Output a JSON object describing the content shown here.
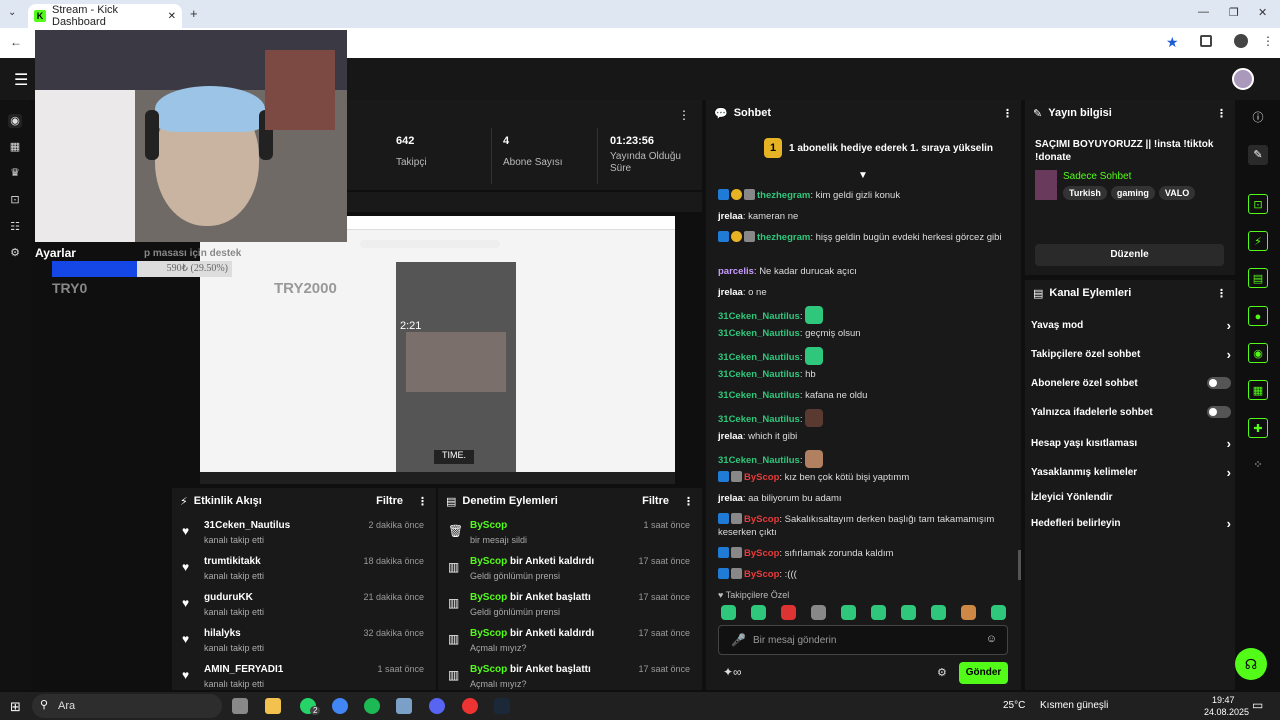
{
  "browser": {
    "tab_title": "Stream - Kick Dashboard"
  },
  "sidebar_overlay": {
    "settings_label": "Ayarlar",
    "goal_title": "TRY2000",
    "goal_current": "TRY0",
    "donate_label": "p masası için destek",
    "progress_text": "590₺ (29.50%)",
    "progress_value": 0.295
  },
  "stats": [
    {
      "value": "642",
      "label": "Takipçi"
    },
    {
      "value": "4",
      "label": "Abone Sayısı"
    },
    {
      "value": "01:23:56",
      "label": "Yayında Olduğu Süre"
    }
  ],
  "activity": {
    "title": "Etkinlik Akışı",
    "filter": "Filtre",
    "items": [
      {
        "name": "31Ceken_Nautilus",
        "sub": "kanalı takip etti",
        "time": "2 dakika önce"
      },
      {
        "name": "trumtikitakk",
        "sub": "kanalı takip etti",
        "time": "18 dakika önce"
      },
      {
        "name": "guduruKK",
        "sub": "kanalı takip etti",
        "time": "21 dakika önce"
      },
      {
        "name": "hilalyks",
        "sub": "kanalı takip etti",
        "time": "32 dakika önce"
      },
      {
        "name": "AMIN_FERYADI1",
        "sub": "kanalı takip etti",
        "time": "1 saat önce"
      }
    ]
  },
  "moderation": {
    "title": "Denetim Eylemleri",
    "filter": "Filtre",
    "items": [
      {
        "user": "ByScop",
        "action": "",
        "sub": "bir mesajı sildi",
        "time": "1 saat önce"
      },
      {
        "user": "ByScop",
        "action": "bir Anketi kaldırdı",
        "sub": "Geldi gönlümün prensi",
        "time": "17 saat önce"
      },
      {
        "user": "ByScop",
        "action": "bir Anket başlattı",
        "sub": "Geldi gönlümün prensi",
        "time": "17 saat önce"
      },
      {
        "user": "ByScop",
        "action": "bir Anketi kaldırdı",
        "sub": "Açmalı mıyız?",
        "time": "17 saat önce"
      },
      {
        "user": "ByScop",
        "action": "bir Anket başlattı",
        "sub": "Açmalı mıyız?",
        "time": "17 saat önce"
      }
    ]
  },
  "chat": {
    "title": "Sohbet",
    "pinned": "1 abonelik hediye ederek 1. sıraya yükselin",
    "pinned_badge": "1",
    "messages": [
      {
        "user": "thezhegram",
        "text": ": kim geldi gizli konuk",
        "color": "#2fc77b"
      },
      {
        "user": "jrelaa",
        "text": ": kameran ne",
        "color": "#ffffff"
      },
      {
        "user": "thezhegram",
        "text": ": hişş geldin bugün evdeki herkesi görcez gibi",
        "color": "#2fc77b"
      },
      {
        "user": "parcelis",
        "text": ": Ne kadar durucak açıcı",
        "color": "#c99cff"
      },
      {
        "user": "jrelaa",
        "text": ": o ne",
        "color": "#ffffff"
      },
      {
        "user": "31Ceken_Nautilus",
        "text": ":",
        "color": "#2fc77b"
      },
      {
        "user": "31Ceken_Nautilus",
        "text": ": geçmiş olsun",
        "color": "#2fc77b"
      },
      {
        "user": "31Ceken_Nautilus",
        "text": ":",
        "color": "#2fc77b"
      },
      {
        "user": "31Ceken_Nautilus",
        "text": ": hb",
        "color": "#2fc77b"
      },
      {
        "user": "31Ceken_Nautilus",
        "text": ": kafana ne oldu",
        "color": "#2fc77b"
      },
      {
        "user": "31Ceken_Nautilus",
        "text": ":",
        "color": "#2fc77b"
      },
      {
        "user": "jrelaa",
        "text": ": which it gibi",
        "color": "#ffffff"
      },
      {
        "user": "31Ceken_Nautilus",
        "text": ":",
        "color": "#2fc77b"
      },
      {
        "user": "ByScop",
        "text": ": kız ben çok kötü bişi yaptımm",
        "color": "#e83b3b"
      },
      {
        "user": "jrelaa",
        "text": ": aa biliyorum bu adamı",
        "color": "#ffffff"
      },
      {
        "user": "ByScop",
        "text": ": Sakalıkısaltayım derken başlığı tam takamamışım keserken çıktı",
        "color": "#e83b3b"
      },
      {
        "user": "ByScop",
        "text": ": sıfırlamak zorunda kaldım",
        "color": "#e83b3b"
      },
      {
        "user": "ByScop",
        "text": ": :(((",
        "color": "#e83b3b"
      }
    ],
    "emote_section": "Takipçilere Özel",
    "placeholder": "Bir mesaj gönderin",
    "send": "Gönder"
  },
  "stream_info": {
    "title": "Yayın bilgisi",
    "stream_title": "SAÇIMI BOYUYORUZZ || !insta !tiktok !donate",
    "category": "Sadece Sohbet",
    "tags": [
      "Turkish",
      "gaming",
      "VALO"
    ],
    "edit": "Düzenle"
  },
  "channel_actions": {
    "title": "Kanal Eylemleri",
    "rows": [
      {
        "label": "Yavaş mod",
        "type": "arrow"
      },
      {
        "label": "Takipçilere özel sohbet",
        "type": "arrow"
      },
      {
        "label": "Abonelere özel sohbet",
        "type": "toggle"
      },
      {
        "label": "Yalnızca ifadelerle sohbet",
        "type": "toggle"
      },
      {
        "label": "Hesap yaşı kısıtlaması",
        "type": "arrow"
      },
      {
        "label": "Yasaklanmış kelimeler",
        "type": "arrow"
      },
      {
        "label": "İzleyici Yönlendir",
        "type": "none"
      },
      {
        "label": "Hedefleri belirleyin",
        "type": "arrow"
      }
    ]
  },
  "taskbar": {
    "search": "Ara",
    "weather_temp": "25°C",
    "weather_text": "Kısmen güneşli",
    "time": "19:47",
    "date": "24.08.2025",
    "badge": "2"
  },
  "colors": {
    "accent": "#53fc18",
    "panel": "#191919",
    "bg": "#0f0f0f"
  }
}
